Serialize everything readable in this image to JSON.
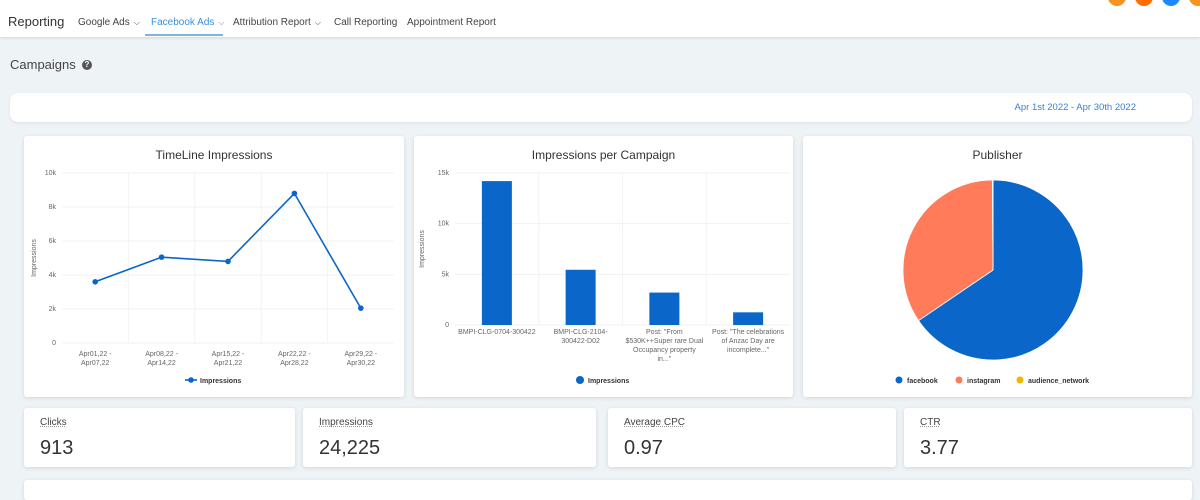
{
  "nav": {
    "brand": "Reporting",
    "items": [
      {
        "label": "Google Ads",
        "dropdown": true
      },
      {
        "label": "Facebook Ads",
        "dropdown": true,
        "active": true
      },
      {
        "label": "Attribution Report",
        "dropdown": true
      },
      {
        "label": "Call Reporting"
      },
      {
        "label": "Appointment Report"
      }
    ]
  },
  "page": {
    "title": "Campaigns",
    "date_range": "Apr 1st 2022 - Apr 30th 2022"
  },
  "colors": {
    "primary": "#0a66c8",
    "instagram": "#ff7b5a",
    "audience_network": "#f5b400",
    "accent": "#3a8fd8"
  },
  "chart_data": [
    {
      "type": "line",
      "title": "TimeLine Impressions",
      "ylabel": "Impressions",
      "ylim": [
        0,
        10000
      ],
      "yticks": [
        "0",
        "2k",
        "4k",
        "6k",
        "8k",
        "10k"
      ],
      "categories": [
        [
          "Apr01,22 -",
          "Apr07,22"
        ],
        [
          "Apr08,22 -",
          "Apr14,22"
        ],
        [
          "Apr15,22 -",
          "Apr21,22"
        ],
        [
          "Apr22,22 -",
          "Apr28,22"
        ],
        [
          "Apr29,22 -",
          "Apr30,22"
        ]
      ],
      "series": [
        {
          "name": "Impressions",
          "values": [
            3600,
            5050,
            4800,
            8800,
            2050
          ]
        }
      ]
    },
    {
      "type": "bar",
      "title": "Impressions per Campaign",
      "ylabel": "Impressions",
      "ylim": [
        0,
        15000
      ],
      "yticks": [
        "0",
        "5k",
        "10k",
        "15k"
      ],
      "categories": [
        [
          "BMPI-CLG-0704-300422"
        ],
        [
          "BMPI-CLG-2104-",
          "300422-D02"
        ],
        [
          "Post: \"From",
          "$530K++Super rare Dual",
          "Occupancy property",
          "in...\""
        ],
        [
          "Post: \"The celebrations",
          "of Anzac Day are",
          "incomplete...\""
        ]
      ],
      "series": [
        {
          "name": "Impressions",
          "values": [
            14200,
            5450,
            3200,
            1250
          ]
        }
      ]
    },
    {
      "type": "pie",
      "title": "Publisher",
      "labels": [
        "facebook",
        "instagram",
        "audience_network"
      ],
      "values": [
        65.5,
        34.4,
        0.1
      ]
    }
  ],
  "kpis": [
    {
      "label": "Clicks",
      "value": "913"
    },
    {
      "label": "Impressions",
      "value": "24,225"
    },
    {
      "label": "Average CPC",
      "value": "0.97"
    },
    {
      "label": "CTR",
      "value": "3.77"
    }
  ]
}
